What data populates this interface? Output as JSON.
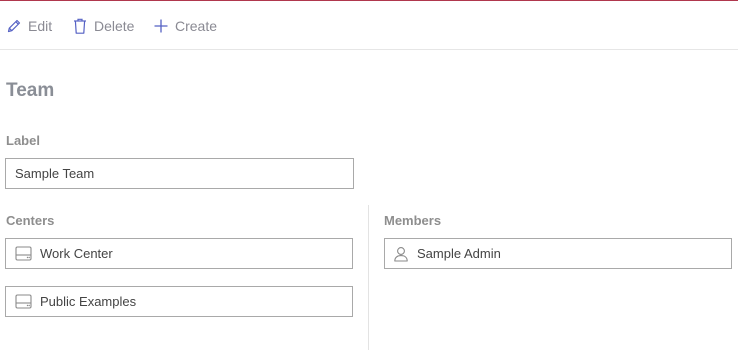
{
  "toolbar": {
    "edit_label": "Edit",
    "delete_label": "Delete",
    "create_label": "Create"
  },
  "page": {
    "title": "Team"
  },
  "form": {
    "label_field": {
      "label": "Label",
      "value": "Sample Team"
    },
    "centers": {
      "label": "Centers",
      "items": [
        {
          "label": "Work Center",
          "icon": "center-icon"
        },
        {
          "label": "Public Examples",
          "icon": "center-icon"
        }
      ]
    },
    "members": {
      "label": "Members",
      "items": [
        {
          "label": "Sample Admin",
          "icon": "user-icon"
        }
      ]
    }
  },
  "colors": {
    "accent": "#b0374d",
    "icon_blue": "#5561c4"
  }
}
